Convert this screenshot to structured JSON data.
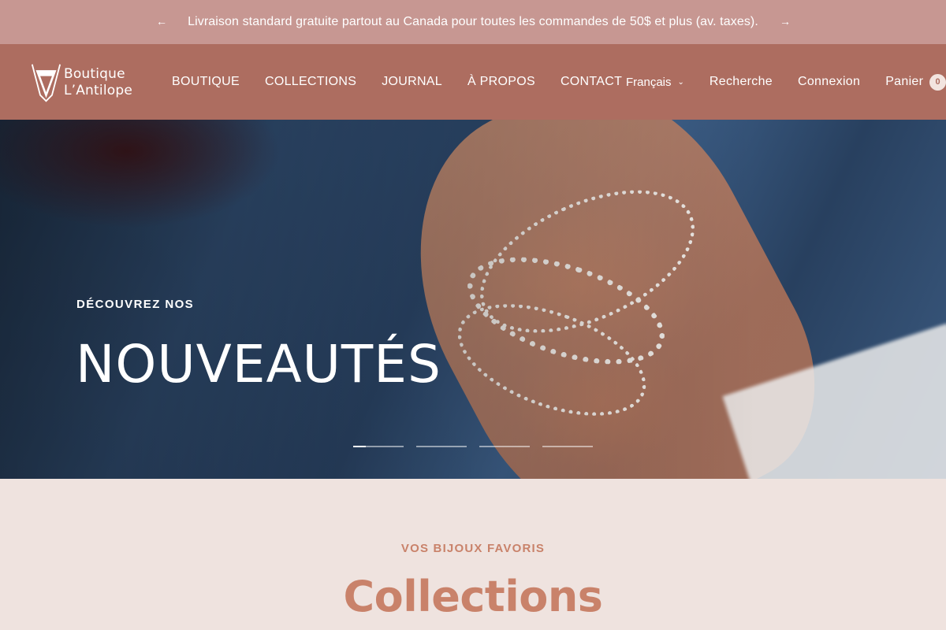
{
  "announcement": {
    "prev_icon": "arrow-left-icon",
    "next_icon": "arrow-right-icon",
    "prev_glyph": "←",
    "next_glyph": "→",
    "message": "Livraison standard gratuite partout au Canada pour toutes les commandes de 50$ et plus (av. taxes)."
  },
  "header": {
    "logo": {
      "line1": "Boutique",
      "line2": "L’Antilope"
    },
    "nav": [
      {
        "label": "BOUTIQUE"
      },
      {
        "label": "COLLECTIONS"
      },
      {
        "label": "JOURNAL"
      },
      {
        "label": "À PROPOS"
      },
      {
        "label": "CONTACT"
      }
    ],
    "language": {
      "selected": "Français",
      "chevron": "⌄"
    },
    "search_label": "Recherche",
    "login_label": "Connexion",
    "cart": {
      "label": "Panier",
      "count": "0"
    }
  },
  "hero": {
    "eyebrow": "DÉCOUVREZ NOS",
    "headline": "NOUVEAUTÉS",
    "slides": 4,
    "active_slide": 1
  },
  "section": {
    "kicker": "VOS BIJOUX FAVORIS",
    "title": "Collections"
  },
  "colors": {
    "announcement_bg": "#c79792",
    "header_bg": "#ad6d60",
    "page_bg": "#efe3df",
    "accent": "#c9826a"
  }
}
